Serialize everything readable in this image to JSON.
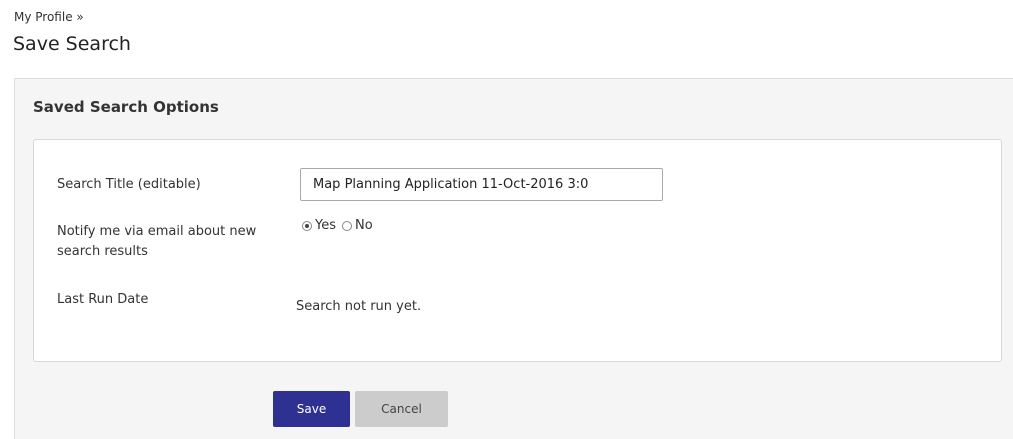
{
  "breadcrumb": {
    "label": "My Profile »"
  },
  "page": {
    "title": "Save Search"
  },
  "section": {
    "title": "Saved Search Options"
  },
  "form": {
    "search_title_label": "Search Title (editable)",
    "search_title_value": "Map Planning Application 11-Oct-2016 3:0",
    "notify_label": "Notify me via email about new search results",
    "notify_options": [
      {
        "label": "Yes",
        "checked": true
      },
      {
        "label": "No",
        "checked": false
      }
    ],
    "last_run_label": "Last Run Date",
    "last_run_value": "Search not run yet."
  },
  "buttons": {
    "save_label": "Save",
    "cancel_label": "Cancel"
  },
  "colors": {
    "save_button_bg": "#2e3192",
    "cancel_button_bg": "#cccccc",
    "panel_bg": "#f5f5f5"
  }
}
